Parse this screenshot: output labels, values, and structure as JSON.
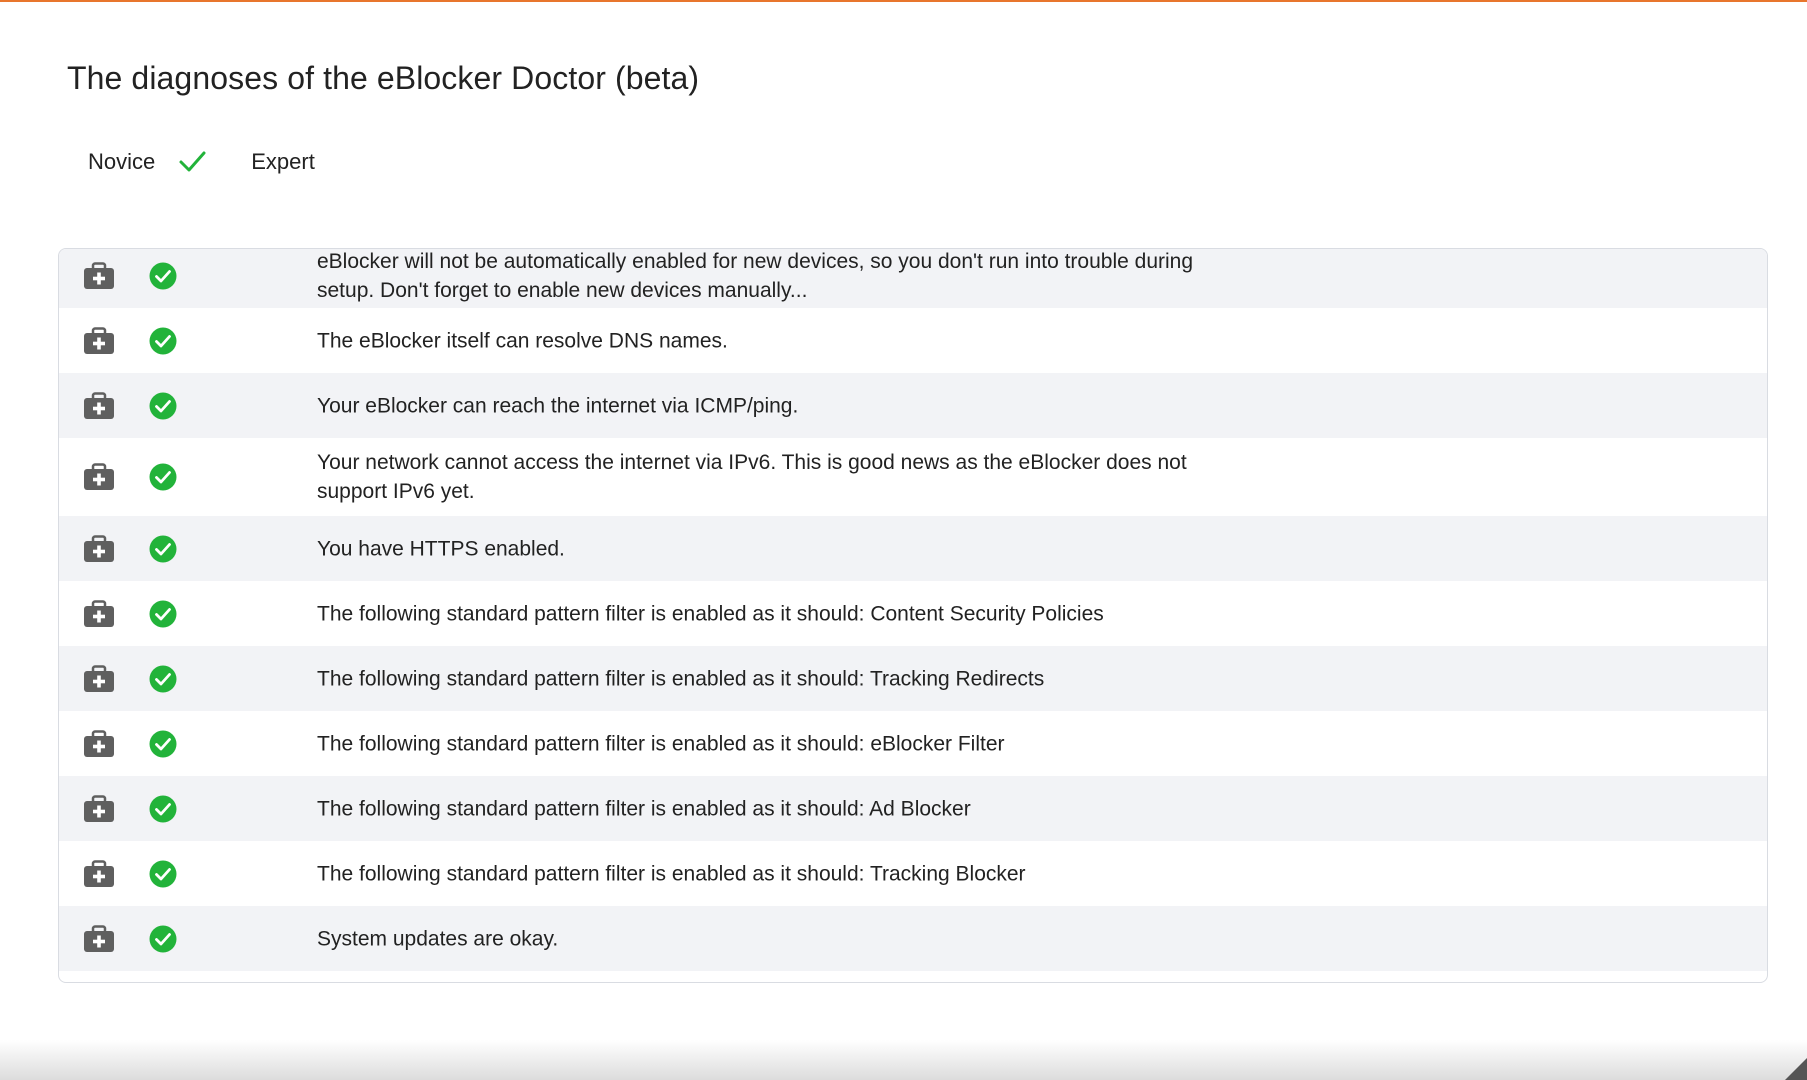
{
  "page": {
    "title": "The diagnoses of the eBlocker Doctor (beta)"
  },
  "mode_toggle": {
    "novice_label": "Novice",
    "expert_label": "Expert",
    "selected": "Novice"
  },
  "colors": {
    "accent": "#e8762d",
    "ok_green": "#22b33a",
    "kit_gray": "#5f5f5f",
    "row_alt": "#f2f3f6"
  },
  "icons": {
    "row_action": "medical-kit-icon",
    "row_status": "check-circle-icon",
    "mode_selected": "checkmark-icon"
  },
  "diagnoses": [
    {
      "status": "ok",
      "text": "eBlocker will not be automatically enabled for new devices, so you don't run into trouble during setup. Don't forget to enable new devices manually..."
    },
    {
      "status": "ok",
      "text": "The eBlocker itself can resolve DNS names."
    },
    {
      "status": "ok",
      "text": "Your eBlocker can reach the internet via ICMP/ping."
    },
    {
      "status": "ok",
      "text": "Your network cannot access the internet via IPv6. This is good news as the eBlocker does not support IPv6 yet."
    },
    {
      "status": "ok",
      "text": "You have HTTPS enabled."
    },
    {
      "status": "ok",
      "text": "The following standard pattern filter is enabled as it should: Content Security Policies"
    },
    {
      "status": "ok",
      "text": "The following standard pattern filter is enabled as it should: Tracking Redirects"
    },
    {
      "status": "ok",
      "text": "The following standard pattern filter is enabled as it should: eBlocker Filter"
    },
    {
      "status": "ok",
      "text": "The following standard pattern filter is enabled as it should: Ad Blocker"
    },
    {
      "status": "ok",
      "text": "The following standard pattern filter is enabled as it should: Tracking Blocker"
    },
    {
      "status": "ok",
      "text": "System updates are okay."
    }
  ]
}
